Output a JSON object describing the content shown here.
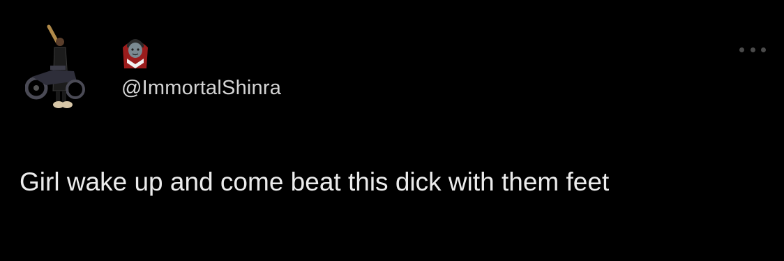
{
  "tweet": {
    "display_name_emoji": "vampire-emoji",
    "handle": "@ImmortalShinra",
    "text": "Girl wake up and come beat this dick with them feet"
  },
  "colors": {
    "background": "#000000",
    "handle": "#d4d4d4",
    "text": "#ececec",
    "more_dots": "#4a4a4a"
  },
  "icons": {
    "avatar": "profile-avatar-motorcycle-figure",
    "more": "more-options-icon"
  }
}
